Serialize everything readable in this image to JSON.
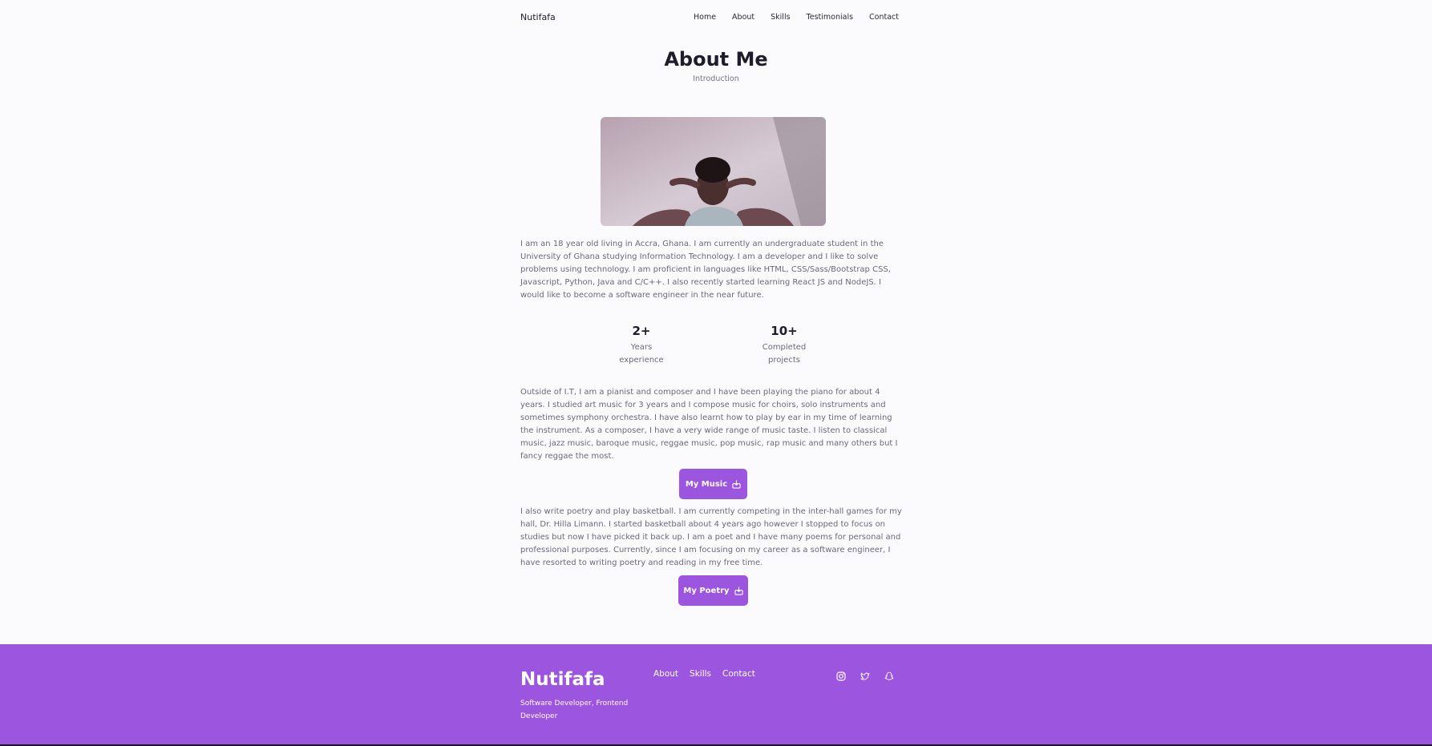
{
  "header": {
    "logo": "Nutifafa",
    "nav": [
      "Home",
      "About",
      "Skills",
      "Testimonials",
      "Contact"
    ]
  },
  "about": {
    "title": "About Me",
    "subtitle": "Introduction",
    "paragraph1": "I am an 18 year old living in Accra, Ghana. I am currently an undergraduate student in the University of Ghana studying Information Technology. I am a developer and I like to solve problems using technology. I am proficient in languages like HTML, CSS/Sass/Bootstrap CSS, Javascript, Python, Java and C/C++. I also recently started learning React JS and NodeJS. I would like to become a software engineer in the near future.",
    "stats": [
      {
        "value": "2+",
        "label_line1": "Years",
        "label_line2": "experience"
      },
      {
        "value": "10+",
        "label_line1": "Completed",
        "label_line2": "projects"
      }
    ],
    "paragraph2": "Outside of I.T, I am a pianist and composer and I have been playing the piano for about 4 years. I studied art music for 3 years and I compose music for choirs, solo instruments and sometimes symphony orchestra. I have also learnt how to play by ear in my time of learning the instrument. As a composer, I have a very wide range of music taste. I listen to classical music, jazz music, baroque music, reggae music, pop music, rap music and many others but I fancy reggae the most.",
    "music_button": "My Music",
    "paragraph3": "I also write poetry and play basketball. I am currently competing in the inter-hall games for my hall, Dr. Hilla Limann. I started basketball about 4 years ago however I stopped to focus on studies but now I have picked it back up. I am a poet and I have many poems for personal and professional purposes. Currently, since I am focusing on my career as a software engineer, I have resorted to writing poetry and reading in my free time.",
    "poetry_button": "My Poetry"
  },
  "footer": {
    "brand": "Nutifafa",
    "tagline": "Software Developer, Frontend Developer",
    "links": [
      "About",
      "Skills",
      "Contact"
    ],
    "social_icons": [
      "instagram-icon",
      "twitter-icon",
      "snapchat-icon"
    ]
  },
  "colors": {
    "accent": "#9b55df",
    "background": "#fbfbfe"
  }
}
